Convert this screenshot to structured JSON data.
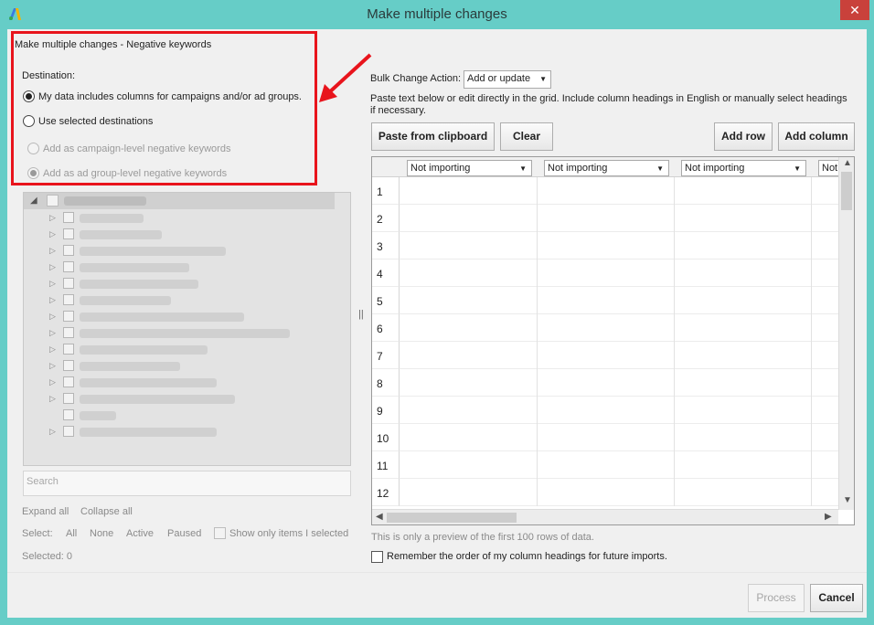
{
  "window": {
    "title": "Make multiple changes",
    "close_label": "✕"
  },
  "colors": {
    "titlebar": "#66cdc7",
    "highlight": "#e8141c",
    "close": "#c9413b"
  },
  "left_panel": {
    "section_title": "Make multiple changes - Negative keywords",
    "destination_label": "Destination:",
    "options": [
      {
        "label": "My data includes columns for campaigns and/or ad groups.",
        "checked": true,
        "enabled": true
      },
      {
        "label": "Use selected destinations",
        "checked": false,
        "enabled": true
      },
      {
        "label": "Add as campaign-level negative keywords",
        "checked": false,
        "enabled": false
      },
      {
        "label": "Add as ad group-level negative keywords",
        "checked": true,
        "enabled": false
      }
    ],
    "search_placeholder": "Search",
    "expand_all": "Expand all",
    "collapse_all": "Collapse all",
    "select_label": "Select:",
    "select_all": "All",
    "select_none": "None",
    "select_active": "Active",
    "select_paused": "Paused",
    "show_only_selected": "Show only items I selected",
    "selected_count": "Selected: 0"
  },
  "right_panel": {
    "bulk_action_label": "Bulk Change Action:",
    "bulk_action_value": "Add or update",
    "help_text": "Paste text below or edit directly in the grid. Include column headings in English or manually select headings if necessary.",
    "paste_button": "Paste from clipboard",
    "clear_button": "Clear",
    "add_row_button": "Add row",
    "add_column_button": "Add column",
    "column_headers": [
      "Not importing",
      "Not importing",
      "Not importing",
      "Not"
    ],
    "row_numbers": [
      "1",
      "2",
      "3",
      "4",
      "5",
      "6",
      "7",
      "8",
      "9",
      "10",
      "11",
      "12"
    ],
    "preview_note": "This is only a preview of the first 100 rows of data.",
    "remember_label": "Remember the order of my column headings for future imports."
  },
  "footer": {
    "process_button": "Process",
    "cancel_button": "Cancel"
  }
}
